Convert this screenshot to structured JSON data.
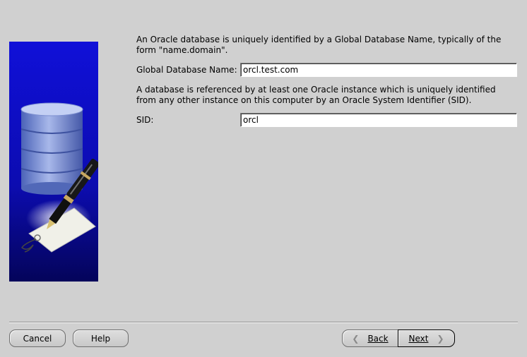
{
  "content": {
    "intro_text": "An Oracle database is uniquely identified by a Global Database Name, typically of the form \"name.domain\".",
    "global_db_name_label": "Global Database Name:",
    "global_db_name_value": "orcl.test.com",
    "sid_intro_text": "A database is referenced by at least one Oracle instance which is uniquely identified from any other instance on this computer by an Oracle System Identifier (SID).",
    "sid_label": "SID:",
    "sid_value": "orcl"
  },
  "buttons": {
    "cancel": "Cancel",
    "help": "Help",
    "back": "Back",
    "next": "Next"
  },
  "icons": {
    "illustration": "database-pen-tag-illustration",
    "back_arrow": "chevron-left-icon",
    "next_arrow": "chevron-right-icon"
  },
  "colors": {
    "background": "#d0d0d0",
    "illustration_blue": "#1010d0",
    "input_background": "#ffffff"
  }
}
